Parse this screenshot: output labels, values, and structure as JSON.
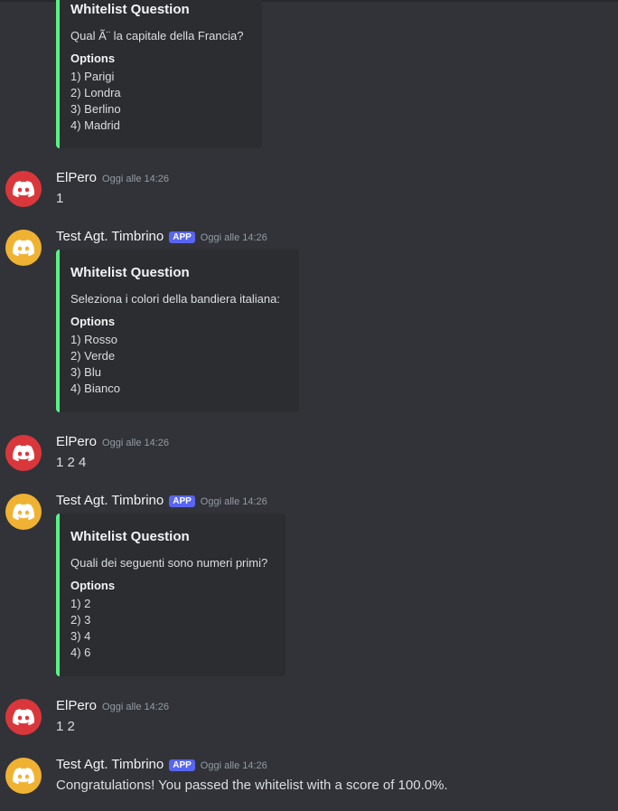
{
  "colors": {
    "background": "#313338",
    "embed_background": "#2b2d31",
    "embed_accent": "#57f287",
    "elpero_avatar": "#da373c",
    "bot_avatar": "#f0b232",
    "app_badge": "#5865f2"
  },
  "icons": {
    "avatar": "discord-logo-icon"
  },
  "messages": [
    {
      "type": "embed-continuation",
      "embed": {
        "title": "Whitelist Question",
        "description": "Qual Ã¨ la capitale della Francia?",
        "field_name": "Options",
        "options": [
          "1) Parigi",
          "2) Londra",
          "3) Berlino",
          "4) Madrid"
        ]
      }
    },
    {
      "author": "ElPero",
      "timestamp": "Oggi alle 14:26",
      "content": "1"
    },
    {
      "author": "Test Agt. Timbrino",
      "badge": "APP",
      "timestamp": "Oggi alle 14:26",
      "embed": {
        "title": "Whitelist Question",
        "description": "Seleziona i colori della bandiera italiana:",
        "field_name": "Options",
        "options": [
          "1) Rosso",
          "2) Verde",
          "3) Blu",
          "4) Bianco"
        ]
      }
    },
    {
      "author": "ElPero",
      "timestamp": "Oggi alle 14:26",
      "content": "1 2 4"
    },
    {
      "author": "Test Agt. Timbrino",
      "badge": "APP",
      "timestamp": "Oggi alle 14:26",
      "embed": {
        "title": "Whitelist Question",
        "description": "Quali dei seguenti sono numeri primi?",
        "field_name": "Options",
        "options": [
          "1) 2",
          "2) 3",
          "3) 4",
          "4) 6"
        ]
      }
    },
    {
      "author": "ElPero",
      "timestamp": "Oggi alle 14:26",
      "content": "1 2"
    },
    {
      "author": "Test Agt. Timbrino",
      "badge": "APP",
      "timestamp": "Oggi alle 14:26",
      "content": "Congratulations! You passed the whitelist with a score of 100.0%."
    }
  ]
}
